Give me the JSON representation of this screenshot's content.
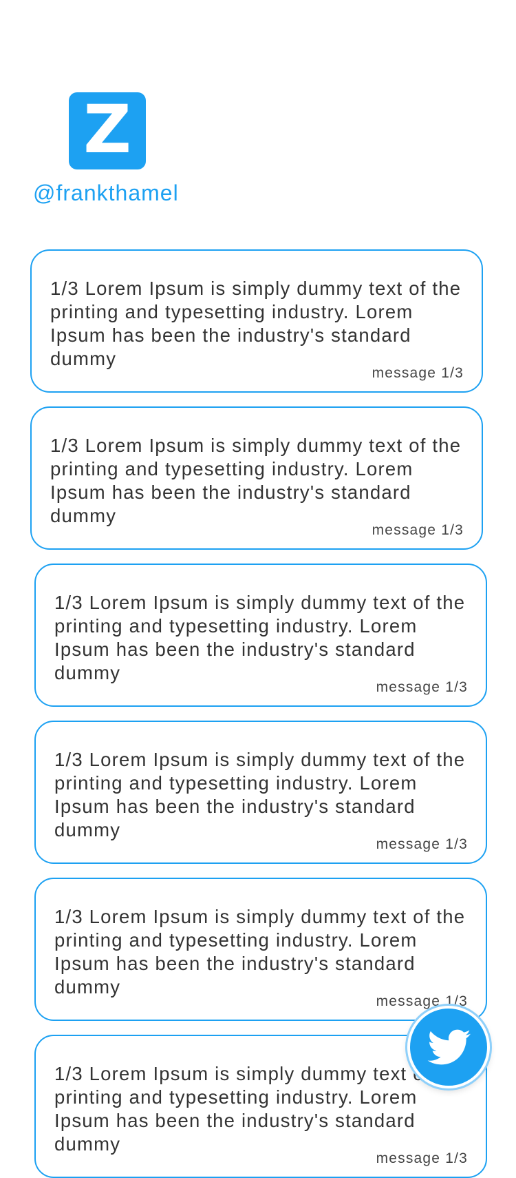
{
  "profile": {
    "logo_letter": "Z",
    "handle": "@frankthamel"
  },
  "messages": [
    {
      "text": "1/3 Lorem Ipsum is simply dummy text of the printing and typesetting industry. Lorem Ipsum has been the industry's standard dummy",
      "meta": "message 1/3"
    },
    {
      "text": "1/3 Lorem Ipsum is simply dummy text of the printing and typesetting industry. Lorem Ipsum has been the industry's standard dummy",
      "meta": "message 1/3"
    },
    {
      "text": "1/3 Lorem Ipsum is simply dummy text of the printing and typesetting industry. Lorem Ipsum has been the industry's standard dummy",
      "meta": "message 1/3"
    },
    {
      "text": "1/3 Lorem Ipsum is simply dummy text of the printing and typesetting industry. Lorem Ipsum has been the industry's standard dummy",
      "meta": "message 1/3"
    },
    {
      "text": "1/3 Lorem Ipsum is simply dummy text of the printing and typesetting industry. Lorem Ipsum has been the industry's standard dummy",
      "meta": "message 1/3"
    },
    {
      "text": "1/3 Lorem Ipsum is simply dummy text of the printing and typesetting industry. Lorem Ipsum has been the industry's standard dummy",
      "meta": "message 1/3"
    }
  ],
  "fab": {
    "icon": "twitter-bird-icon"
  },
  "colors": {
    "accent": "#1da1f2",
    "text": "#333333",
    "background": "#ffffff"
  }
}
